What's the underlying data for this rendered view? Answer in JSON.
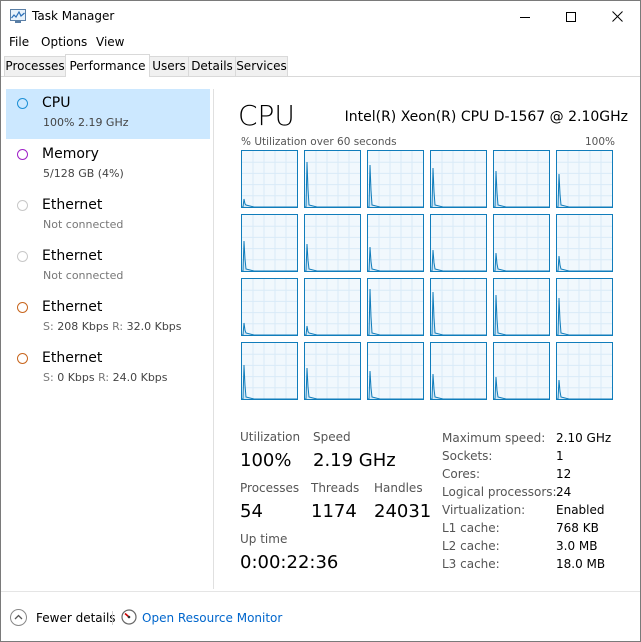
{
  "window": {
    "title": "Task Manager",
    "icon": "task-manager-icon"
  },
  "menu": [
    "File",
    "Options",
    "View"
  ],
  "tabs": [
    {
      "label": "Processes",
      "active": false
    },
    {
      "label": "Performance",
      "active": true
    },
    {
      "label": "Users",
      "active": false
    },
    {
      "label": "Details",
      "active": false
    },
    {
      "label": "Services",
      "active": false
    }
  ],
  "sidebar": {
    "items": [
      {
        "name": "CPU",
        "sub": "100%  2.19 GHz",
        "selected": true,
        "color": "#1e90d6"
      },
      {
        "name": "Memory",
        "sub": "5/128 GB (4%)",
        "selected": false,
        "color": "#a020c8"
      },
      {
        "name": "Ethernet",
        "sub": "Not connected",
        "selected": false,
        "color": "#c8c8c8"
      },
      {
        "name": "Ethernet",
        "sub": "Not connected",
        "selected": false,
        "color": "#c8c8c8"
      },
      {
        "name": "Ethernet",
        "sub_s_label": "S:",
        "sub_s": "208 Kbps",
        "sub_r_label": "R:",
        "sub_r": "32.0 Kbps",
        "selected": false,
        "color": "#c8661e"
      },
      {
        "name": "Ethernet",
        "sub_s_label": "S:",
        "sub_s": "0 Kbps",
        "sub_r_label": "R:",
        "sub_r": "24.0 Kbps",
        "selected": false,
        "color": "#c8661e"
      }
    ]
  },
  "cpu": {
    "title": "CPU",
    "model": "Intel(R) Xeon(R) CPU D-1567 @ 2.10GHz",
    "graph_label": "% Utilization over 60 seconds",
    "graph_max": "100%",
    "graph_color": "#117dbb",
    "logical_processor_count": 24
  },
  "stats": {
    "utilization_label": "Utilization",
    "utilization_value": "100%",
    "speed_label": "Speed",
    "speed_value": "2.19 GHz",
    "processes_label": "Processes",
    "processes_value": "54",
    "threads_label": "Threads",
    "threads_value": "1174",
    "handles_label": "Handles",
    "handles_value": "24031",
    "uptime_label": "Up time",
    "uptime_value": "0:00:22:36"
  },
  "specs": [
    {
      "label": "Maximum speed:",
      "value": "2.10 GHz"
    },
    {
      "label": "Sockets:",
      "value": "1"
    },
    {
      "label": "Cores:",
      "value": "12"
    },
    {
      "label": "Logical processors:",
      "value": "24"
    },
    {
      "label": "Virtualization:",
      "value": "Enabled"
    },
    {
      "label": "L1 cache:",
      "value": "768 KB"
    },
    {
      "label": "L2 cache:",
      "value": "3.0 MB"
    },
    {
      "label": "L3 cache:",
      "value": "18.0 MB"
    }
  ],
  "footer": {
    "fewer_details": "Fewer details",
    "resource_monitor": "Open Resource Monitor"
  }
}
